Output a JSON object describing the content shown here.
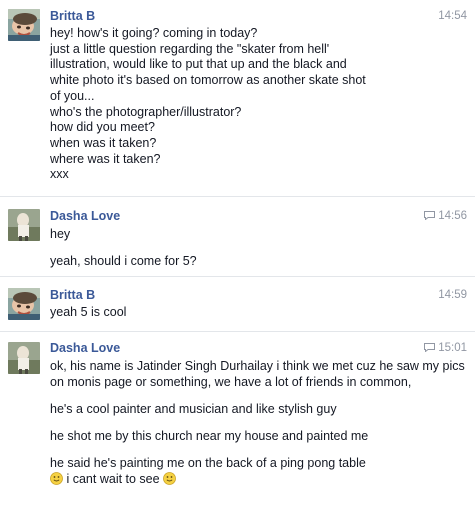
{
  "messages": [
    {
      "sender": "Britta B",
      "time": "14:54",
      "seen_icon": false,
      "lines": [
        "hey! how's it going? coming in today?",
        "just a little question regarding the \"skater from hell'",
        "illustration, would like to put that up and the black and",
        "white photo it's based on tomorrow as another skate shot",
        "of you...",
        "who's the photographer/illustrator?",
        "how did you meet?",
        "when was it taken?",
        "where was it taken?",
        "xxx"
      ]
    },
    {
      "sender": "Dasha Love",
      "time": "14:56",
      "seen_icon": true,
      "paragraphs": [
        "hey",
        "yeah, should i come for 5?"
      ]
    },
    {
      "sender": "Britta B",
      "time": "14:59",
      "seen_icon": false,
      "paragraphs": [
        "yeah 5 is cool"
      ]
    },
    {
      "sender": "Dasha Love",
      "time": "15:01",
      "seen_icon": true,
      "paragraphs": [
        "ok, his name is Jatinder Singh Durhailay i think we met cuz he saw my pics on monis page or something, we have a lot of friends in common,",
        "he's a cool painter and musician and like stylish guy",
        "he shot me by this church near my house and painted me",
        "he said he's painting me on the back of a ping pong table"
      ],
      "last_line_text": "i cant wait to see"
    }
  ],
  "icons": {
    "seen": "message-seen-icon",
    "emoticon": "smile-emoticon-icon"
  }
}
